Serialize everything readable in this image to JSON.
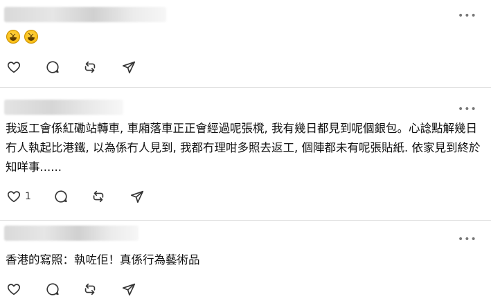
{
  "icons": {
    "more": "more-dots-icon",
    "like": "heart-icon",
    "reply": "comment-icon",
    "repost": "repost-icon",
    "share": "send-icon"
  },
  "posts": [
    {
      "author_blurred": true,
      "text": "",
      "emoji": [
        "grinning-squinting-face",
        "grinning-squinting-face"
      ],
      "like_count": ""
    },
    {
      "author_blurred": true,
      "text": "我返工會係紅磡站轉車, 車廂落車正正會經過呢張櫈, 我有幾日都見到呢個銀包。心諗點解幾日冇人執起比港鐵, 以為係冇人見到, 我都冇理咁多照去返工, 個陣都未有呢張貼紙. 依家見到終於知咩事......",
      "like_count": "1"
    },
    {
      "author_blurred": true,
      "text": "香港的寫照：執咗佢！真係行為藝術品",
      "like_count": ""
    }
  ],
  "more_label": "•••"
}
